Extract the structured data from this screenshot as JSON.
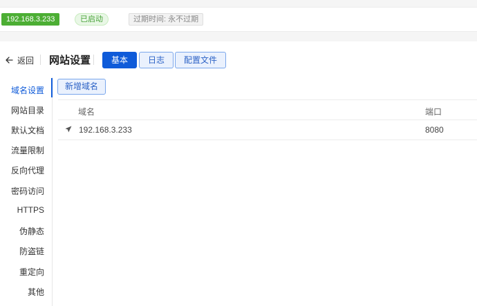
{
  "topbar": {
    "site_address": "192.168.3.233",
    "status": "已启动",
    "expire": "过期时间: 永不过期"
  },
  "header": {
    "back_label": "返回",
    "title": "网站设置",
    "tabs": [
      {
        "label": "基本",
        "active": true
      },
      {
        "label": "日志",
        "active": false
      },
      {
        "label": "配置文件",
        "active": false
      }
    ]
  },
  "sidebar": {
    "items": [
      {
        "label": "域名设置",
        "active": true
      },
      {
        "label": "网站目录",
        "active": false
      },
      {
        "label": "默认文档",
        "active": false
      },
      {
        "label": "流量限制",
        "active": false
      },
      {
        "label": "反向代理",
        "active": false
      },
      {
        "label": "密码访问",
        "active": false
      },
      {
        "label": "HTTPS",
        "active": false
      },
      {
        "label": "伪静态",
        "active": false
      },
      {
        "label": "防盗链",
        "active": false
      },
      {
        "label": "重定向",
        "active": false
      },
      {
        "label": "其他",
        "active": false
      }
    ]
  },
  "main": {
    "add_button": "新增域名",
    "table": {
      "columns": [
        "域名",
        "端口"
      ],
      "rows": [
        {
          "domain": "192.168.3.233",
          "port": "8080",
          "icon": "send-icon"
        }
      ]
    }
  },
  "colors": {
    "primary": "#0f5bd9",
    "site_badge": "#4cae34",
    "status_green": "#49a33a"
  }
}
